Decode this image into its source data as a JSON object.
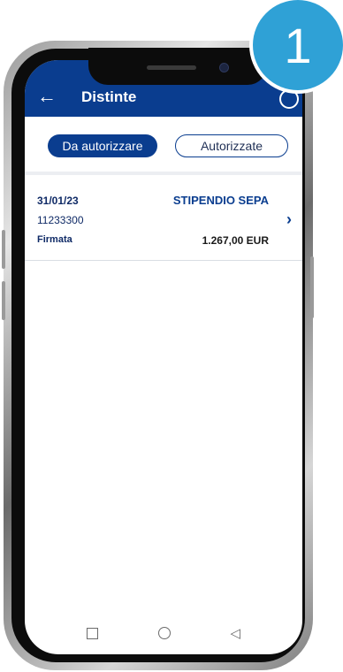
{
  "step_badge": "1",
  "header": {
    "title": "Distinte",
    "back_icon": "arrow-left-icon"
  },
  "tabs": [
    {
      "label": "Da autorizzare",
      "active": true
    },
    {
      "label": "Autorizzate",
      "active": false
    }
  ],
  "items": [
    {
      "date": "31/01/23",
      "title": "STIPENDIO SEPA",
      "code": "11233300",
      "status": "Firmata",
      "amount": "1.267,00 EUR"
    }
  ],
  "colors": {
    "primary": "#0a3d8f",
    "badge": "#2fa1d6"
  }
}
